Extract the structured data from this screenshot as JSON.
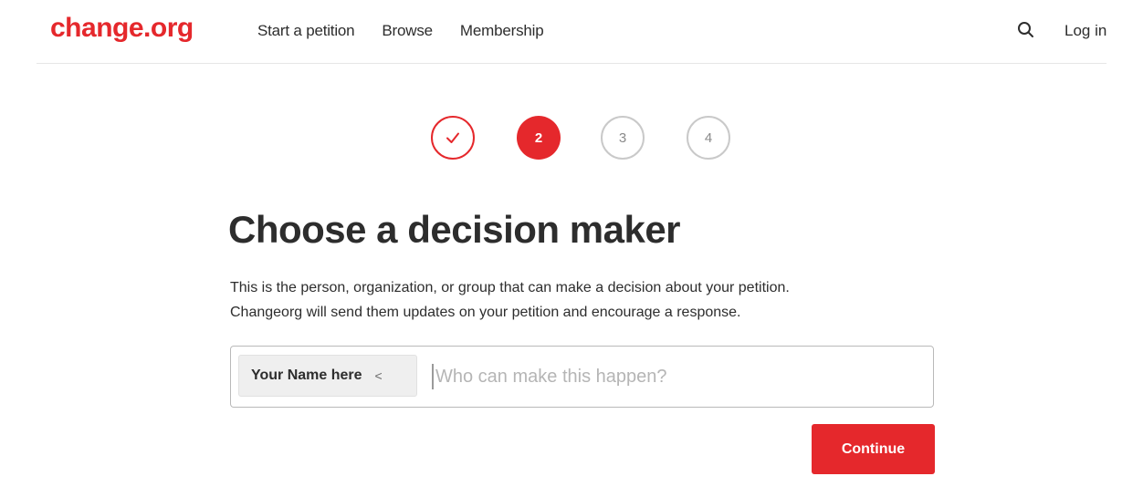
{
  "header": {
    "logo": "change.org",
    "nav": [
      {
        "label": "Start a petition"
      },
      {
        "label": "Browse"
      },
      {
        "label": "Membership"
      }
    ],
    "search_icon": "search-icon",
    "login_label": "Log in"
  },
  "stepper": {
    "steps": [
      {
        "state": "completed",
        "icon": "check-icon"
      },
      {
        "state": "current",
        "label": "2"
      },
      {
        "state": "upcoming",
        "label": "3"
      },
      {
        "state": "upcoming",
        "label": "4"
      }
    ]
  },
  "main": {
    "title": "Choose a decision maker",
    "description_line1": "This is the person, organization, or group that can make a decision about your petition.",
    "description_line2": "Changeorg will send them updates on your petition and encourage a response.",
    "decision_maker_field": {
      "chip_label": "Your Name here",
      "chip_remove_icon": "close-icon",
      "chip_remove_glyph": "<",
      "input_value": "",
      "placeholder": "Who can make this happen?"
    },
    "continue_label": "Continue"
  },
  "colors": {
    "brand": "#e5282c",
    "text": "#2d2d2d",
    "muted_border": "#c9c9c9"
  }
}
